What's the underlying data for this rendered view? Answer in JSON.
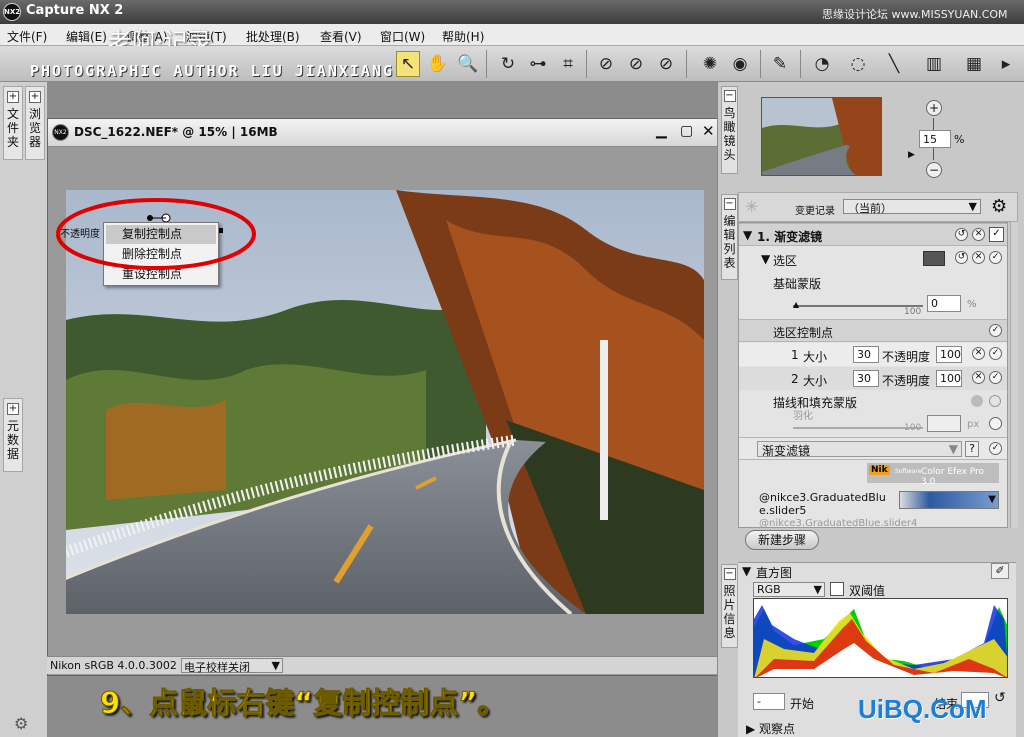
{
  "app": {
    "title": "Capture NX 2",
    "logo": "NX2",
    "watermark": "思缘设计论坛 www.MISSYUAN.COM"
  },
  "menu": [
    {
      "label": "文件(F)"
    },
    {
      "label": "编辑(E)"
    },
    {
      "label": "调整(A)"
    },
    {
      "label": "滤镜(T)"
    },
    {
      "label": "批处理(B)"
    },
    {
      "label": "查看(V)"
    },
    {
      "label": "窗口(W)"
    },
    {
      "label": "帮助(H)"
    }
  ],
  "overlay": {
    "author_cn": "老阿·记录",
    "author_en": "PHOTOGRAPHIC AUTHOR LIU JIANXIANG",
    "caption": "9、点鼠标右键“复制控制点”。",
    "site": "UiBQ.CoM"
  },
  "left_tabs": {
    "folders": "文件夹",
    "browser": "浏览器",
    "metadata": "元数据"
  },
  "document": {
    "title": "DSC_1622.NEF* @ 15% | 16MB",
    "cp_label": "不透明度"
  },
  "context_menu": {
    "items": [
      "复制控制点",
      "删除控制点",
      "重设控制点"
    ],
    "highlighted": 0
  },
  "status": {
    "profile": "Nikon sRGB 4.0.0.3002",
    "proof": "电子校样关闭"
  },
  "right_tabs": {
    "birdseye": "鸟瞰镜头",
    "edit_list": "编辑列表",
    "photo_info": "照片信息"
  },
  "navigator": {
    "zoom": "15",
    "unit": "%"
  },
  "edit_list": {
    "history_label": "变更记录",
    "history_value": "（当前）",
    "step_title": "1. 渐变滤镜",
    "selection": "选区",
    "base_mask": "基础蒙版",
    "base_mask_max": "100",
    "base_mask_value": "0",
    "base_mask_unit": "%",
    "cp_section": "选区控制点",
    "control_points": [
      {
        "index": "1",
        "size_label": "大小",
        "size": "30",
        "opacity_label": "不透明度",
        "opacity": "100"
      },
      {
        "index": "2",
        "size_label": "大小",
        "size": "30",
        "opacity_label": "不透明度",
        "opacity": "100"
      }
    ],
    "stroke_fill": "描线和填充蒙版",
    "feather": "羽化",
    "feather_max": "100",
    "feather_unit": "px",
    "filter_select": "渐变滤镜",
    "help": "?",
    "plugin_logo": "Nik",
    "plugin_logo_sub": "Software",
    "plugin_name": "Color Efex Pro 3.0",
    "filter_name_1": "@nikce3.GraduatedBlue.slider5",
    "filter_name_2": "@nikce3.GraduatedBlue.slider4",
    "new_step": "新建步骤"
  },
  "histogram": {
    "title": "直方图",
    "channel": "RGB",
    "threshold": "双阈值",
    "start_label": "开始",
    "end_label": "结束",
    "start_value": "-",
    "watch_points": "观察点"
  },
  "colors": {
    "caption": "#ffe000",
    "highlight_ring": "#e00000",
    "site": "#1c7fd6"
  }
}
